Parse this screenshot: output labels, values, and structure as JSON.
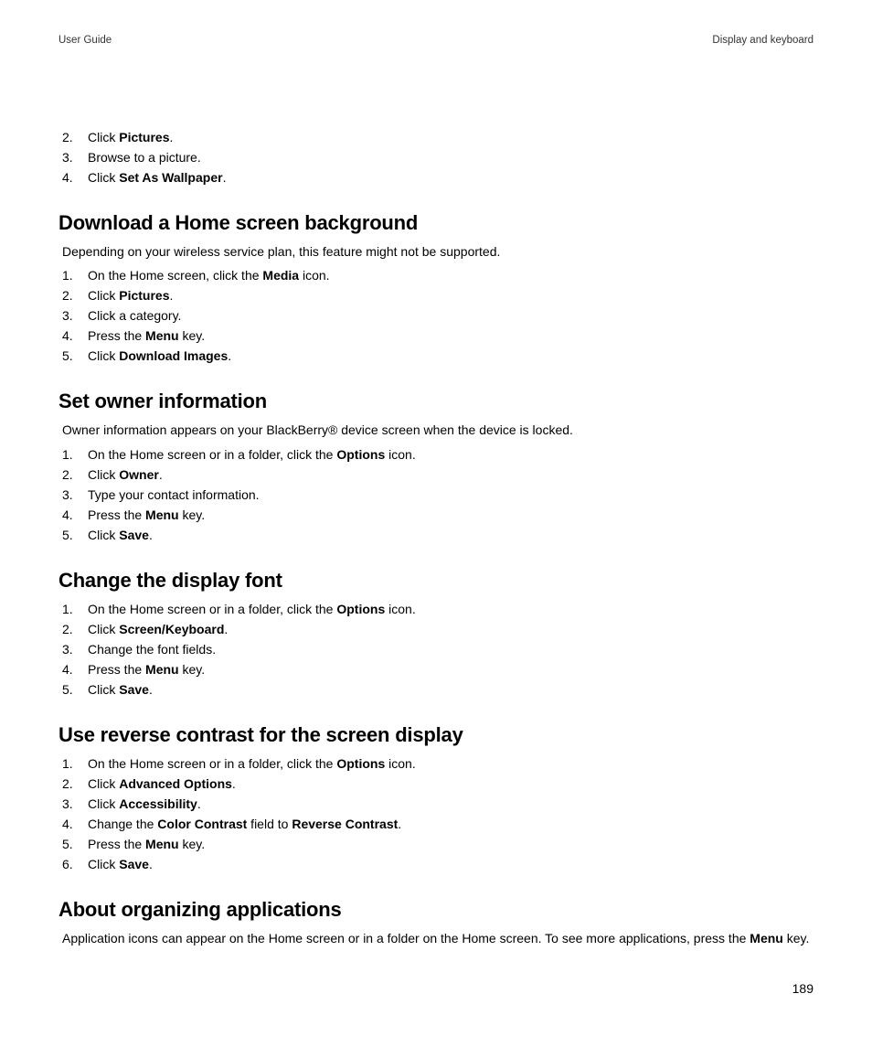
{
  "header": {
    "left": "User Guide",
    "right": "Display and keyboard"
  },
  "page_number": "189",
  "intro_steps": [
    {
      "n": "2.",
      "parts": [
        {
          "t": "Click "
        },
        {
          "t": "Pictures",
          "b": true
        },
        {
          "t": "."
        }
      ]
    },
    {
      "n": "3.",
      "parts": [
        {
          "t": "Browse to a picture."
        }
      ]
    },
    {
      "n": "4.",
      "parts": [
        {
          "t": "Click "
        },
        {
          "t": "Set As Wallpaper",
          "b": true
        },
        {
          "t": "."
        }
      ]
    }
  ],
  "sections": [
    {
      "title": "Download a Home screen background",
      "intro": "Depending on your wireless service plan, this feature might not be supported.",
      "steps": [
        {
          "n": "1.",
          "parts": [
            {
              "t": "On the Home screen, click the "
            },
            {
              "t": "Media",
              "b": true
            },
            {
              "t": " icon."
            }
          ]
        },
        {
          "n": "2.",
          "parts": [
            {
              "t": "Click "
            },
            {
              "t": "Pictures",
              "b": true
            },
            {
              "t": "."
            }
          ]
        },
        {
          "n": "3.",
          "parts": [
            {
              "t": "Click a category."
            }
          ]
        },
        {
          "n": "4.",
          "parts": [
            {
              "t": "Press the "
            },
            {
              "t": "Menu",
              "b": true
            },
            {
              "t": " key."
            }
          ]
        },
        {
          "n": "5.",
          "parts": [
            {
              "t": "Click "
            },
            {
              "t": "Download Images",
              "b": true
            },
            {
              "t": "."
            }
          ]
        }
      ]
    },
    {
      "title": "Set owner information",
      "intro": "Owner information appears on your BlackBerry® device screen when the device is locked.",
      "steps": [
        {
          "n": "1.",
          "parts": [
            {
              "t": "On the Home screen or in a folder, click the "
            },
            {
              "t": "Options",
              "b": true
            },
            {
              "t": " icon."
            }
          ]
        },
        {
          "n": "2.",
          "parts": [
            {
              "t": "Click "
            },
            {
              "t": "Owner",
              "b": true
            },
            {
              "t": "."
            }
          ]
        },
        {
          "n": "3.",
          "parts": [
            {
              "t": "Type your contact information."
            }
          ]
        },
        {
          "n": "4.",
          "parts": [
            {
              "t": "Press the "
            },
            {
              "t": "Menu",
              "b": true
            },
            {
              "t": " key."
            }
          ]
        },
        {
          "n": "5.",
          "parts": [
            {
              "t": "Click "
            },
            {
              "t": "Save",
              "b": true
            },
            {
              "t": "."
            }
          ]
        }
      ]
    },
    {
      "title": "Change the display font",
      "intro": null,
      "steps": [
        {
          "n": "1.",
          "parts": [
            {
              "t": "On the Home screen or in a folder, click the "
            },
            {
              "t": "Options",
              "b": true
            },
            {
              "t": " icon."
            }
          ]
        },
        {
          "n": "2.",
          "parts": [
            {
              "t": "Click "
            },
            {
              "t": "Screen/Keyboard",
              "b": true
            },
            {
              "t": "."
            }
          ]
        },
        {
          "n": "3.",
          "parts": [
            {
              "t": "Change the font fields."
            }
          ]
        },
        {
          "n": "4.",
          "parts": [
            {
              "t": "Press the "
            },
            {
              "t": "Menu",
              "b": true
            },
            {
              "t": " key."
            }
          ]
        },
        {
          "n": "5.",
          "parts": [
            {
              "t": "Click "
            },
            {
              "t": "Save",
              "b": true
            },
            {
              "t": "."
            }
          ]
        }
      ]
    },
    {
      "title": "Use reverse contrast for the screen display",
      "intro": null,
      "steps": [
        {
          "n": "1.",
          "parts": [
            {
              "t": "On the Home screen or in a folder, click the "
            },
            {
              "t": "Options",
              "b": true
            },
            {
              "t": " icon."
            }
          ]
        },
        {
          "n": "2.",
          "parts": [
            {
              "t": "Click "
            },
            {
              "t": "Advanced Options",
              "b": true
            },
            {
              "t": "."
            }
          ]
        },
        {
          "n": "3.",
          "parts": [
            {
              "t": "Click "
            },
            {
              "t": "Accessibility",
              "b": true
            },
            {
              "t": "."
            }
          ]
        },
        {
          "n": "4.",
          "parts": [
            {
              "t": "Change the "
            },
            {
              "t": "Color Contrast",
              "b": true
            },
            {
              "t": " field to "
            },
            {
              "t": "Reverse Contrast",
              "b": true
            },
            {
              "t": "."
            }
          ]
        },
        {
          "n": "5.",
          "parts": [
            {
              "t": "Press the "
            },
            {
              "t": "Menu",
              "b": true
            },
            {
              "t": " key."
            }
          ]
        },
        {
          "n": "6.",
          "parts": [
            {
              "t": "Click "
            },
            {
              "t": "Save",
              "b": true
            },
            {
              "t": "."
            }
          ]
        }
      ]
    },
    {
      "title": "About organizing applications",
      "intro_rich": [
        {
          "t": "Application icons can appear on the Home screen or in a folder on the Home screen. To see more applications, press the "
        },
        {
          "t": "Menu",
          "b": true
        },
        {
          "t": " key."
        }
      ],
      "steps": []
    }
  ]
}
